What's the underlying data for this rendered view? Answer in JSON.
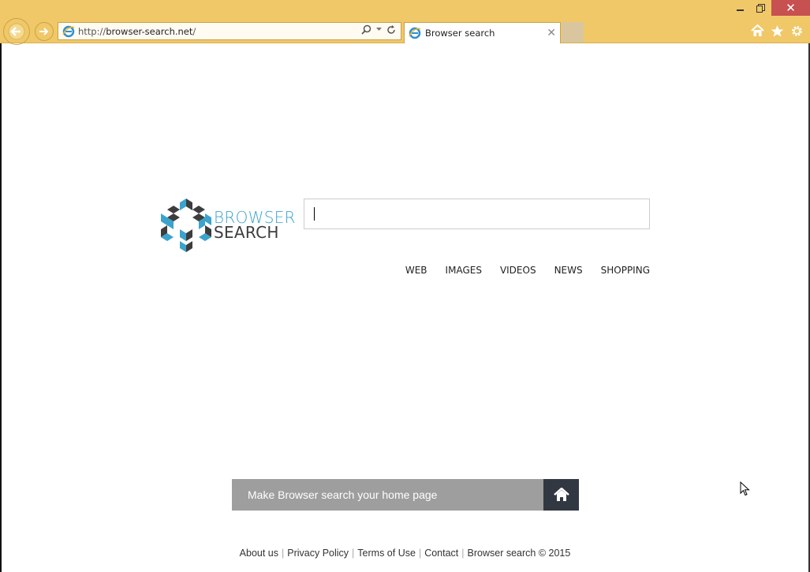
{
  "browser": {
    "url_prefix": "http://",
    "url_domain": "browser-search.net",
    "url_suffix": "/",
    "tab_title": "Browser search",
    "window_controls": {
      "minimize": "minimize",
      "restore": "restore",
      "close": "✕"
    },
    "toolbar_icons": [
      "home-icon",
      "star-icon",
      "gear-icon"
    ]
  },
  "page": {
    "logo": {
      "line1": "BROWSER",
      "line2": "SEARCH",
      "colors": {
        "blue": "#3ba3cc",
        "dark": "#3d3d3d"
      }
    },
    "search": {
      "value": "",
      "placeholder": ""
    },
    "nav": [
      {
        "label": "WEB"
      },
      {
        "label": "IMAGES"
      },
      {
        "label": "VIDEOS"
      },
      {
        "label": "NEWS"
      },
      {
        "label": "SHOPPING"
      }
    ],
    "homepage_cta": "Make Browser search your home page",
    "footer": {
      "links": [
        "About us",
        "Privacy Policy",
        "Terms of Use",
        "Contact"
      ],
      "copyright": "Browser search © 2015"
    }
  }
}
